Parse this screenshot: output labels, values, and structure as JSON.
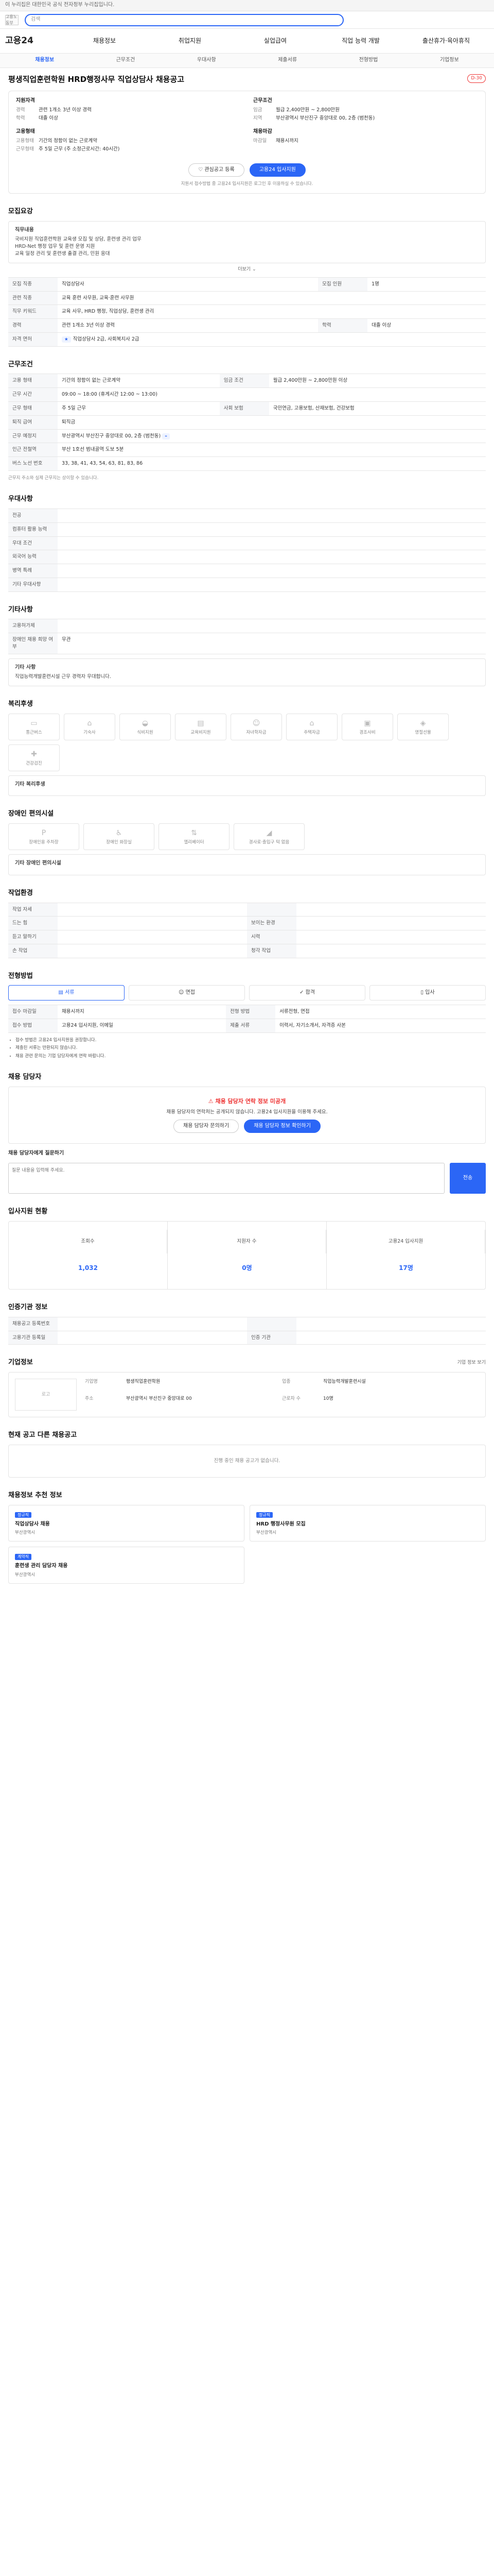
{
  "topbar": {
    "notice": "이 누리집은 대한민국 공식 전자정부 누리집입니다."
  },
  "header": {
    "logo": "고용노동부",
    "search_placeholder": "검색"
  },
  "gnb": {
    "logo": "고용24",
    "items": [
      "채용정보",
      "취업지원",
      "실업급여",
      "직업 능력 개발",
      "출산휴가·육아휴직"
    ]
  },
  "subnav": [
    "채용정보",
    "근무조건",
    "우대사항",
    "제출서류",
    "전형방법",
    "기업정보"
  ],
  "job": {
    "title": "평생직업훈련학원 HRD행정사무 직업상담사 채용공고",
    "dday": "D-30"
  },
  "summary": {
    "left_a_title": "지원자격",
    "left_a": [
      {
        "k": "경력",
        "v": "관련 1개소 3년 이상 경력"
      },
      {
        "k": "학력",
        "v": "대졸 이상"
      }
    ],
    "right_a_title": "근무조건",
    "right_a": [
      {
        "k": "임금",
        "v": "월급 2,400만원 ~ 2,800만원"
      },
      {
        "k": "지역",
        "v": "부산광역시 부산진구 중앙대로 00, 2층 (범천동)"
      }
    ],
    "left_b_title": "고용형태",
    "left_b": [
      {
        "k": "고용형태",
        "v": "기간의 정함이 없는 근로계약"
      },
      {
        "k": "근무형태",
        "v": "주 5일 근무 (주 소정근로시간: 40시간)"
      }
    ],
    "right_b_title": "채용마감",
    "right_b": [
      {
        "k": "마감일",
        "v": "채용시까지"
      }
    ],
    "btn_save": "관심공고 등록",
    "btn_apply": "고용24 입사지원",
    "note": "지원서 접수방법 중 고용24 입사지원은 로그인 후 이용하실 수 있습니다."
  },
  "recruit": {
    "title": "모집요강",
    "box_title": "직무내용",
    "box_lines": [
      "국비지원 직업훈련학원 교육생 모집 및 상담, 훈련생 관리 업무",
      "HRD-Net 행정 업무 및 훈련 운영 지원",
      "교육 일정 관리 및 훈련생 출결 관리, 민원 응대"
    ],
    "more": "더보기",
    "rows": [
      {
        "k": "모집 직종",
        "v": "직업상담사"
      },
      {
        "k": "모집 인원",
        "v": "1명"
      },
      {
        "k": "관련 직종",
        "v": "교육 훈련 사무원, 교육·훈련 사무원"
      },
      {
        "k": "직무 키워드",
        "v": "교육 사무, HRD 행정, 직업상담, 훈련생 관리"
      },
      {
        "k": "경력",
        "v": "관련 1개소 3년 이상 경력"
      },
      {
        "k": "학력",
        "v": "대졸 이상"
      },
      {
        "k": "자격 면허",
        "v": "직업상담사 2급, 사회복지사 2급"
      }
    ]
  },
  "conditions": {
    "title": "근무조건",
    "rows": [
      {
        "k": "고용 형태",
        "v": "기간의 정함이 없는 근로계약"
      },
      {
        "k": "임금 조건",
        "v": "월급 2,400만원 ~ 2,800만원 이상"
      },
      {
        "k": "근무 시간",
        "v": "09:00 ~ 18:00 (휴게시간 12:00 ~ 13:00)"
      },
      {
        "k": "근무 형태",
        "v": "주 5일 근무"
      },
      {
        "k": "사회 보험",
        "v": "국민연금, 고용보험, 산재보험, 건강보험"
      },
      {
        "k": "퇴직 급여",
        "v": "퇴직금"
      },
      {
        "k": "근무 예정지",
        "v": "부산광역시 부산진구 중앙대로 00, 2층 (범천동)"
      },
      {
        "k": "인근 전철역",
        "v": "부산 1호선 범내골역 도보 5분"
      },
      {
        "k": "버스 노선 번호",
        "v": "33, 38, 41, 43, 54, 63, 81, 83, 86"
      }
    ],
    "note": "근무지 주소와 실제 근무지는 상이할 수 있습니다."
  },
  "prefs": {
    "title": "우대사항",
    "rows": [
      {
        "k": "전공",
        "v": ""
      },
      {
        "k": "컴퓨터 활용 능력",
        "v": ""
      },
      {
        "k": "우대 조건",
        "v": ""
      },
      {
        "k": "외국어 능력",
        "v": ""
      },
      {
        "k": "병역 특례",
        "v": ""
      },
      {
        "k": "기타 우대사항",
        "v": ""
      }
    ]
  },
  "others": {
    "title": "기타사항",
    "rows": [
      {
        "k": "고용허가제",
        "v": ""
      },
      {
        "k": "장애인 채용 희망 여부",
        "v": "무관"
      }
    ],
    "box_title": "기타 사항",
    "box_text": "직업능력개발훈련시설 근무 경력자 우대합니다."
  },
  "welfare": {
    "title": "복리후생",
    "items": [
      "통근버스",
      "기숙사",
      "식비지원",
      "교육비지원",
      "자녀학자금",
      "주택자금",
      "경조사비",
      "명절선물",
      "건강검진"
    ],
    "box": "기타 복리후생"
  },
  "facility": {
    "title": "장애인 편의시설",
    "items": [
      "장애인용 주차장",
      "장애인 화장실",
      "엘리베이터",
      "경사로·출입구 턱 없음"
    ],
    "box": "기타 장애인 편의시설"
  },
  "env": {
    "title": "작업환경",
    "rows": [
      {
        "k1": "작업 자세",
        "v1": "",
        "k2": "",
        "v2": ""
      },
      {
        "k1": "드는 힘",
        "v1": "",
        "k2": "보이는 환경",
        "v2": ""
      },
      {
        "k1": "듣고 말하기",
        "v1": "",
        "k2": "시력",
        "v2": ""
      },
      {
        "k1": "손 작업",
        "v1": "",
        "k2": "청각 작업",
        "v2": ""
      }
    ]
  },
  "process": {
    "title": "전형방법",
    "steps": [
      "서류",
      "면접",
      "합격",
      "입사"
    ],
    "rows": [
      {
        "k": "접수 마감일",
        "v": "채용시까지"
      },
      {
        "k": "전형 방법",
        "v": "서류전형, 면접"
      },
      {
        "k": "접수 방법",
        "v": "고용24 입사지원, 이메일"
      },
      {
        "k": "제출 서류",
        "v": "이력서, 자기소개서, 자격증 사본"
      }
    ],
    "bullets": [
      "접수 방법은 고용24 입사지원을 권장합니다.",
      "제출된 서류는 반환되지 않습니다.",
      "채용 관련 문의는 기업 담당자에게 연락 바랍니다."
    ]
  },
  "apply": {
    "title": "채용 담당자",
    "warn": "채용 담당자 연락 정보 미공개",
    "text": "채용 담당자의 연락처는 공개되지 않습니다. 고용24 입사지원을 이용해 주세요.",
    "btn1": "채용 담당자 문의하기",
    "btn2": "채용 담당자 정보 확인하기",
    "qa_title": "채용 담당자에게 질문하기",
    "qa_placeholder": "질문 내용을 입력해 주세요.",
    "qa_btn": "전송"
  },
  "stats": {
    "title": "입사지원 현황",
    "items": [
      {
        "lbl": "조회수",
        "val": "1,032"
      },
      {
        "lbl": "지원자 수",
        "val": "0명"
      },
      {
        "lbl": "고용24 입사지원",
        "val": "17명"
      }
    ]
  },
  "mgmt": {
    "title": "인증기관 정보",
    "rows": [
      {
        "k": "채용공고 등록번호",
        "v": "",
        "k2": "",
        "v2": ""
      },
      {
        "k": "고용기관 등록일",
        "v": "",
        "k2": "인증 기관",
        "v2": ""
      }
    ]
  },
  "company": {
    "title": "기업정보",
    "logo": "로고",
    "name": "평생직업훈련학원",
    "fields": [
      {
        "k": "기업명",
        "v": "평생직업훈련학원"
      },
      {
        "k": "업종",
        "v": "직업능력개발훈련시설"
      },
      {
        "k": "주소",
        "v": "부산광역시 부산진구 중앙대로 00"
      },
      {
        "k": "근로자 수",
        "v": "10명"
      }
    ],
    "btn": "기업 정보 보기"
  },
  "related": {
    "title": "현재 공고 다른 채용공고",
    "empty": "진행 중인 채용 공고가 없습니다."
  },
  "recommend": {
    "title": "채용정보 추천 정보",
    "items": [
      {
        "badge": "정규직",
        "ttl": "직업상담사 채용",
        "meta": "부산광역시"
      },
      {
        "badge": "정규직",
        "ttl": "HRD 행정사무원 모집",
        "meta": "부산광역시"
      },
      {
        "badge": "계약직",
        "ttl": "훈련생 관리 담당자 채용",
        "meta": "부산광역시"
      }
    ]
  }
}
